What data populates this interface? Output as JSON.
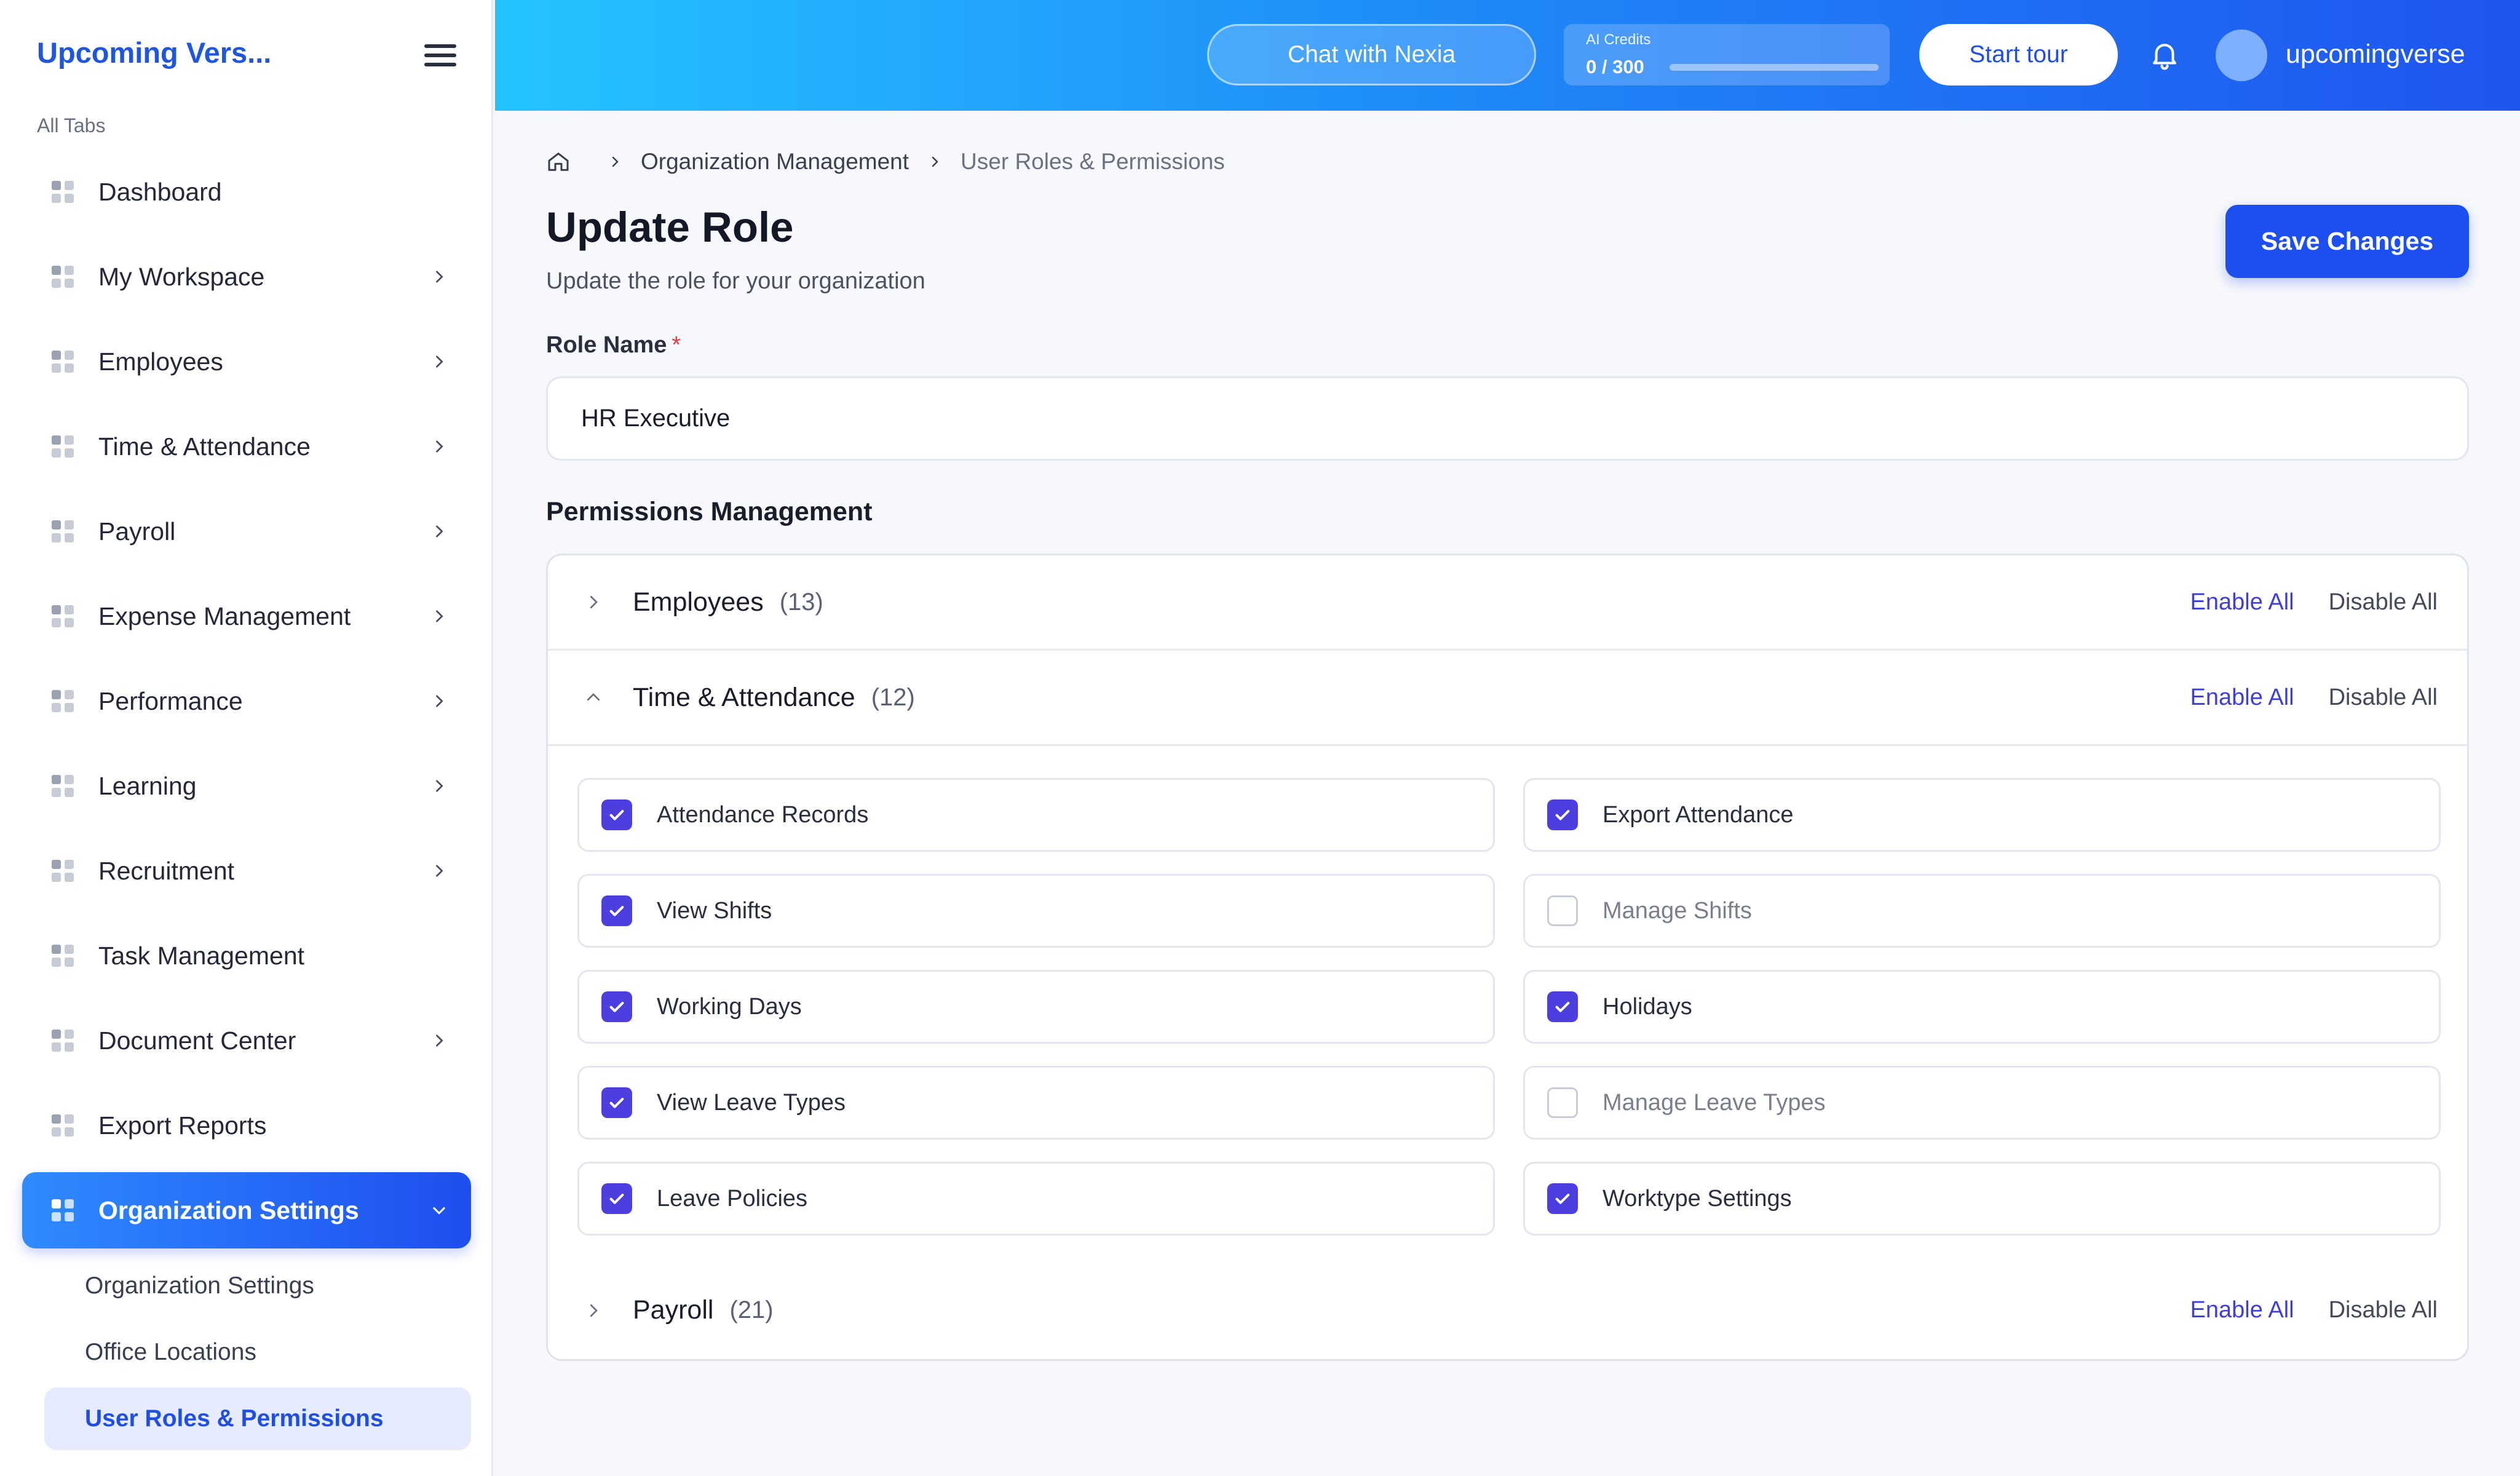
{
  "sidebar": {
    "brand": "Upcoming Vers...",
    "all_tabs_label": "All Tabs",
    "items": [
      {
        "label": "Dashboard",
        "chevron": false
      },
      {
        "label": "My Workspace",
        "chevron": true
      },
      {
        "label": "Employees",
        "chevron": true
      },
      {
        "label": "Time & Attendance",
        "chevron": true
      },
      {
        "label": "Payroll",
        "chevron": true
      },
      {
        "label": "Expense Management",
        "chevron": true
      },
      {
        "label": "Performance",
        "chevron": true
      },
      {
        "label": "Learning",
        "chevron": true
      },
      {
        "label": "Recruitment",
        "chevron": true
      },
      {
        "label": "Task Management",
        "chevron": false
      },
      {
        "label": "Document Center",
        "chevron": true
      },
      {
        "label": "Export Reports",
        "chevron": false
      },
      {
        "label": "Organization Settings",
        "chevron": true,
        "active": true
      }
    ],
    "sub_items": [
      {
        "label": "Organization Settings"
      },
      {
        "label": "Office Locations"
      },
      {
        "label": "User Roles & Permissions",
        "active": true
      }
    ]
  },
  "topbar": {
    "chat_label": "Chat with Nexia",
    "credits_label": "AI Credits",
    "credits_value": "0 / 300",
    "credits_used_fraction": 0,
    "tour_label": "Start tour",
    "username": "upcomingverse"
  },
  "breadcrumb": {
    "items": [
      "Organization Management",
      "User Roles & Permissions"
    ]
  },
  "page": {
    "title": "Update Role",
    "subtitle": "Update the role for your organization",
    "save_label": "Save Changes"
  },
  "role": {
    "label": "Role Name",
    "required_mark": "*",
    "value": "HR Executive"
  },
  "permissions": {
    "title": "Permissions Management",
    "enable_all": "Enable All",
    "disable_all": "Disable All",
    "groups": [
      {
        "title": "Employees",
        "count": "(13)",
        "expanded": false
      },
      {
        "title": "Time & Attendance",
        "count": "(12)",
        "expanded": true
      },
      {
        "title": "Payroll",
        "count": "(21)",
        "expanded": false
      }
    ],
    "items": [
      {
        "label": "Attendance Records",
        "checked": true
      },
      {
        "label": "Export Attendance",
        "checked": true
      },
      {
        "label": "View Shifts",
        "checked": true
      },
      {
        "label": "Manage Shifts",
        "checked": false
      },
      {
        "label": "Working Days",
        "checked": true
      },
      {
        "label": "Holidays",
        "checked": true
      },
      {
        "label": "View Leave Types",
        "checked": true
      },
      {
        "label": "Manage Leave Types",
        "checked": false
      },
      {
        "label": "Leave Policies",
        "checked": true
      },
      {
        "label": "Worktype Settings",
        "checked": true
      }
    ]
  },
  "colors": {
    "accent": "#1d4ff0",
    "checkbox": "#4d3ee0",
    "link": "#3d3fd6",
    "required": "#e53b3b"
  }
}
